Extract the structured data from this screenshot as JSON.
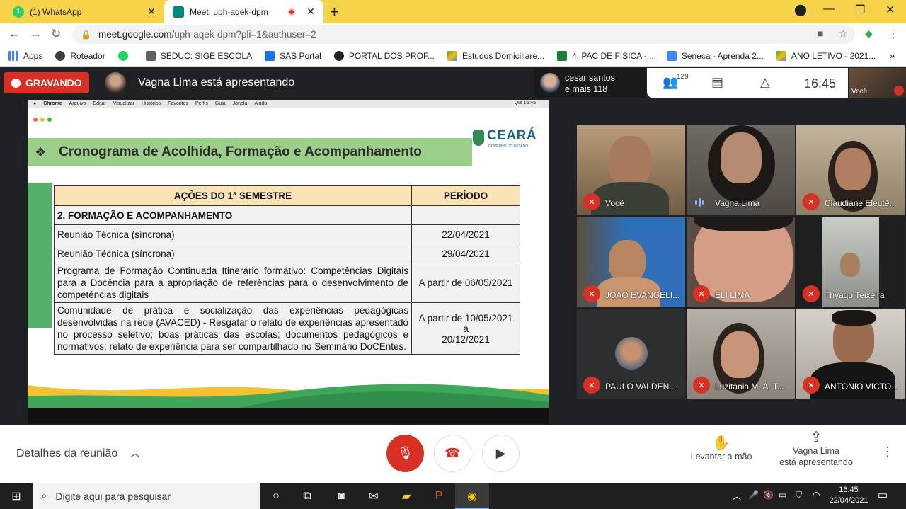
{
  "browser": {
    "tabs": [
      {
        "title": "(1) WhatsApp",
        "badge": "1",
        "active": false
      },
      {
        "title": "Meet: uph-aqek-dpm",
        "active": true
      }
    ],
    "url_host": "meet.google.com",
    "url_path": "/uph-aqek-dpm?pli=1&authuser=2",
    "bookmarks": [
      {
        "label": "Apps",
        "color": "#4285f4"
      },
      {
        "label": "Roteador",
        "color": "#3c4043"
      },
      {
        "label": "",
        "color": "#25d366"
      },
      {
        "label": "SEDUC: SIGE ESCOLA",
        "color": "#5f6368"
      },
      {
        "label": "SAS Portal",
        "color": "#1a73e8"
      },
      {
        "label": "PORTAL DOS PROF...",
        "color": "#202124"
      },
      {
        "label": "Estudos Domiciliare...",
        "color": "#fbbc04"
      },
      {
        "label": "4. PAC DE FÍSICA -...",
        "color": "#188038"
      },
      {
        "label": "Seneca - Aprenda 2...",
        "color": "#4285f4"
      },
      {
        "label": "ANO LETIVO - 2021...",
        "color": "#fbbc04"
      }
    ]
  },
  "meet": {
    "recording_label": "GRAVANDO",
    "presenting_text": "Vagna Lima está apresentando",
    "top_participant": {
      "line1": "cesar santos",
      "line2": "e mais 118"
    },
    "participant_count": "129",
    "time": "16:45",
    "self_label": "Você",
    "tiles": [
      {
        "name": "Você",
        "muted": true
      },
      {
        "name": "Vagna Lima",
        "muted": false
      },
      {
        "name": "Claudiane Eleuté...",
        "muted": true
      },
      {
        "name": "JOAO EVANGELI...",
        "muted": true
      },
      {
        "name": "ELI LIMA",
        "muted": true
      },
      {
        "name": "Thyago Teixeira",
        "muted": true
      },
      {
        "name": "PAULO VALDEN...",
        "muted": true
      },
      {
        "name": "Luzitânia M. A. T...",
        "muted": true
      },
      {
        "name": "ANTONIO VICTO...",
        "muted": true
      }
    ],
    "bottom": {
      "details": "Detalhes da reunião",
      "raise_hand": "Levantar a mão",
      "presenting_line1": "Vagna Lima",
      "presenting_line2": "está apresentando"
    }
  },
  "slide": {
    "mac_menu": [
      "Chrome",
      "Arquivo",
      "Editar",
      "Visualizar",
      "Histórico",
      "Favoritos",
      "Perfis",
      "Guia",
      "Janela",
      "Ajuda"
    ],
    "mac_time": "Qui 16:45",
    "logo_word": "CEARÁ",
    "logo_sub": "GOVERNO DO ESTADO",
    "title": "Cronograma de Acolhida, Formação e Acompanhamento",
    "table": {
      "head_action": "AÇÕES DO 1ª SEMESTRE",
      "head_period": "PERÍODO",
      "section": "2. FORMAÇÃO E ACOMPANHAMENTO",
      "rows": [
        {
          "action": "Reunião Técnica (síncrona)",
          "period": "22/04/2021"
        },
        {
          "action": "Reunião Técnica (síncrona)",
          "period": "29/04/2021"
        },
        {
          "action": "Programa de Formação Continuada Itinerário formativo: Competências Digitais para a Docência para a apropriação de referências para o desenvolvimento de competências digitais",
          "period": "A partir de 06/05/2021"
        },
        {
          "action": "Comunidade de prática e socialização das experiências pedagógicas desenvolvidas na rede (AVACED) - Resgatar o relato de experiências apresentado no processo seletivo; boas práticas das escolas; documentos pedagógicos e normativos; relato de experiência para ser compartilhado no Seminário DoCEntes.",
          "period_line1": "A partir de 10/05/2021",
          "period_line2": "a",
          "period_line3": "20/12/2021"
        }
      ]
    }
  },
  "taskbar": {
    "search_placeholder": "Digite aqui para pesquisar",
    "time": "16:45",
    "date": "22/04/2021"
  }
}
